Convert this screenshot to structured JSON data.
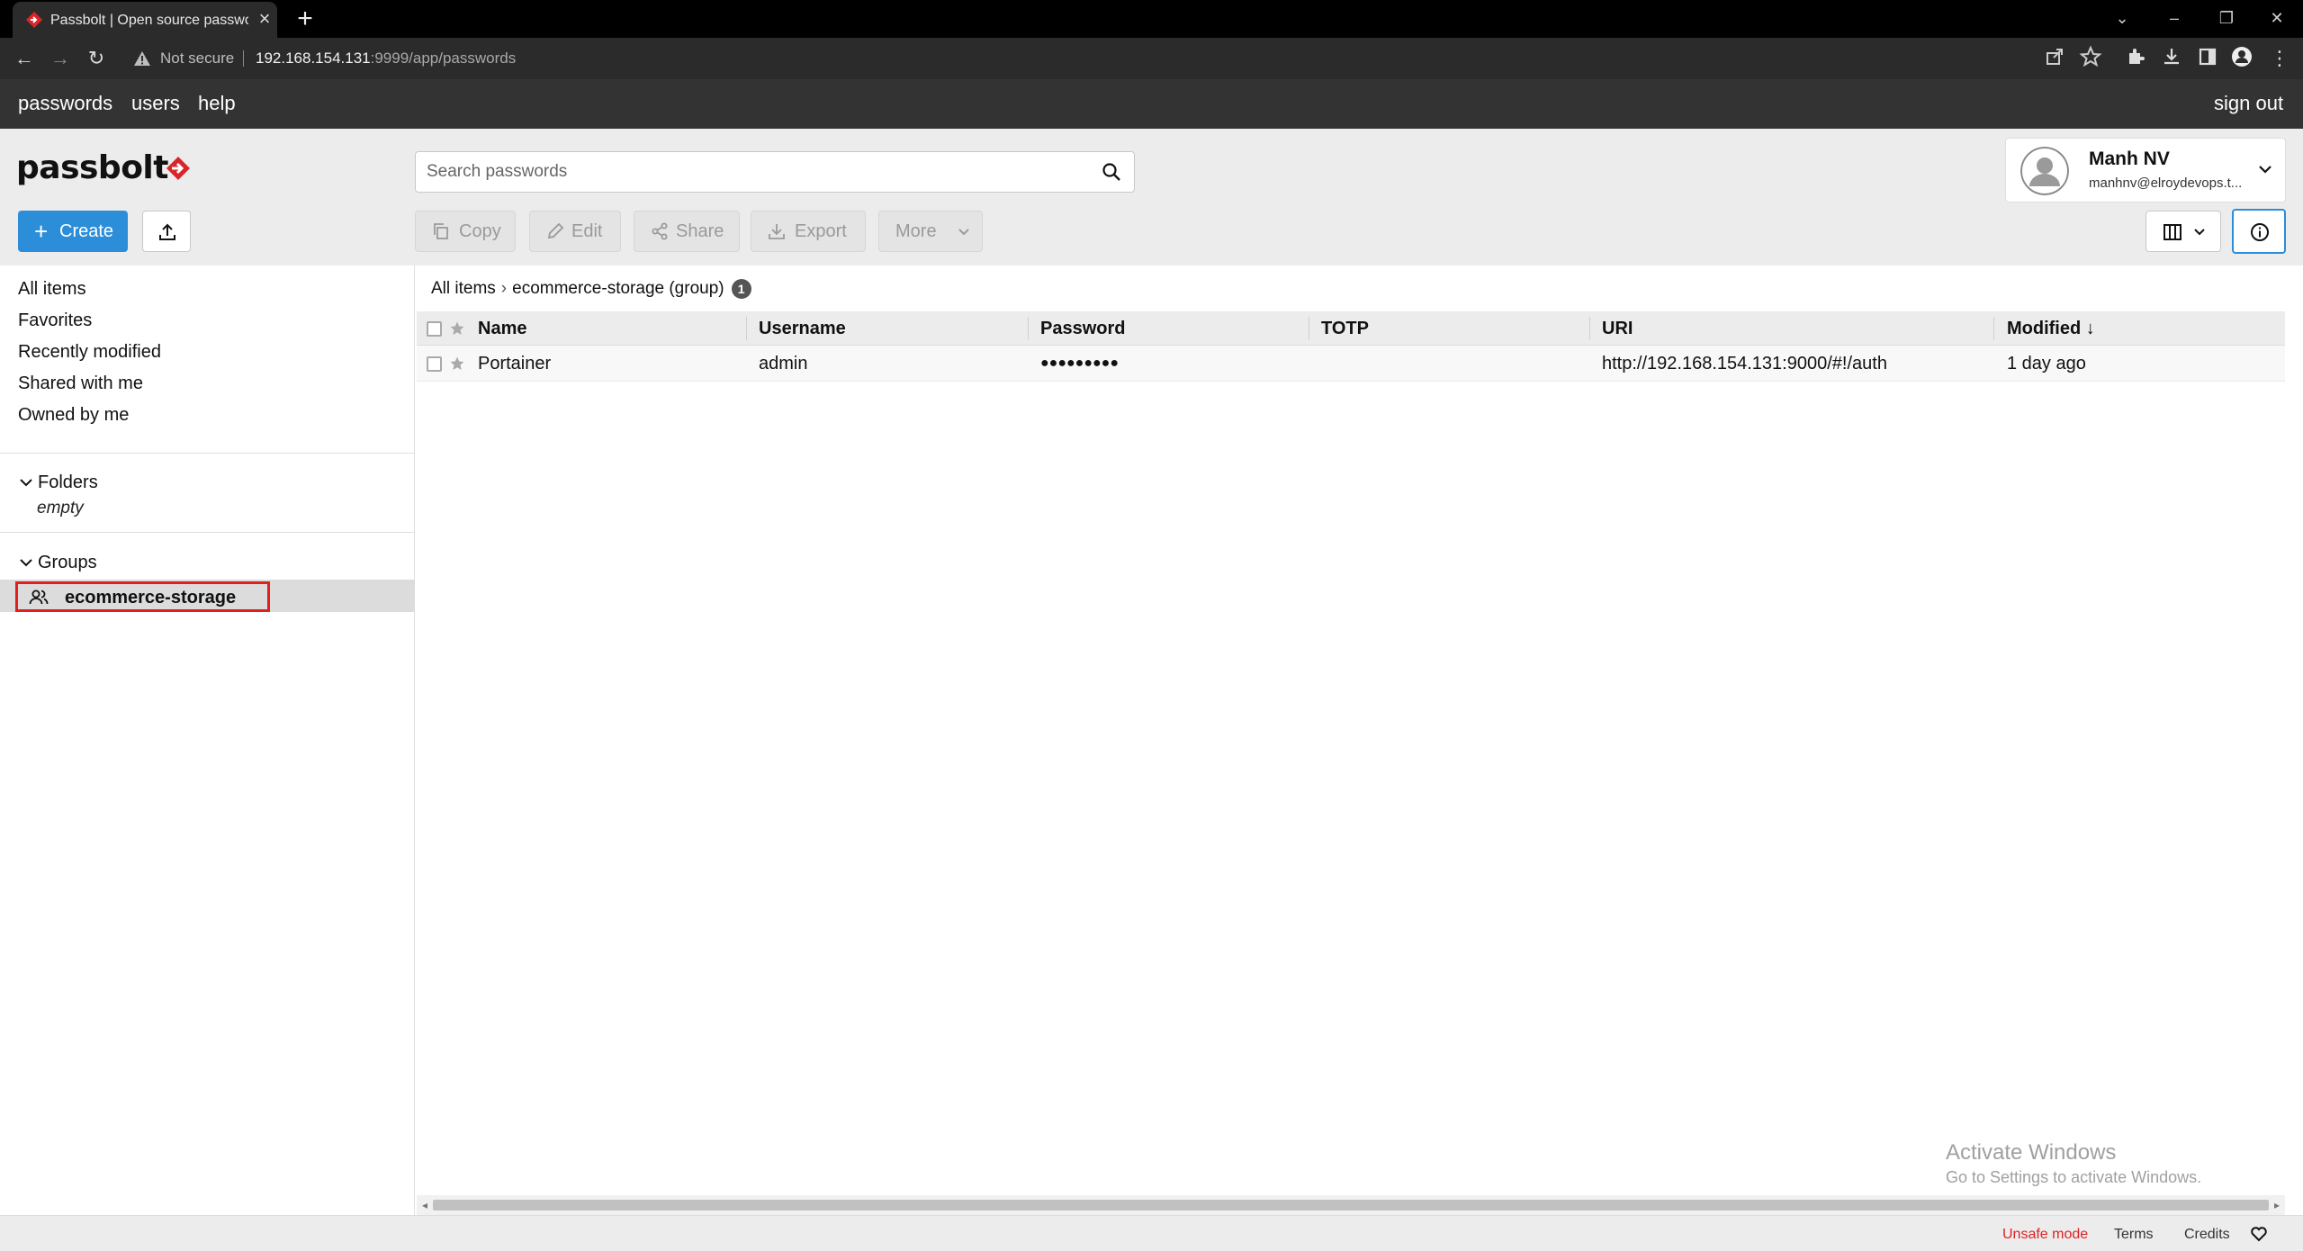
{
  "browser": {
    "tab_title": "Passbolt | Open source password manager",
    "security_label": "Not secure",
    "url_host": "192.168.154.131",
    "url_rest": ":9999/app/passwords"
  },
  "topnav": {
    "passwords": "passwords",
    "users": "users",
    "help": "help",
    "sign_out": "sign out"
  },
  "header": {
    "logo": "passbolt",
    "search_placeholder": "Search passwords",
    "user_name": "Manh NV",
    "user_email": "manhnv@elroydevops.t..."
  },
  "toolbar": {
    "create": "Create",
    "copy": "Copy",
    "edit": "Edit",
    "share": "Share",
    "export": "Export",
    "more": "More"
  },
  "sidebar": {
    "filters": [
      "All items",
      "Favorites",
      "Recently modified",
      "Shared with me",
      "Owned by me"
    ],
    "folders_label": "Folders",
    "folders_empty": "empty",
    "groups_label": "Groups",
    "group_selected": "ecommerce-storage"
  },
  "breadcrumb": {
    "root": "All items",
    "separator": "›",
    "current": "ecommerce-storage (group)",
    "count": "1"
  },
  "grid": {
    "columns": {
      "name": "Name",
      "username": "Username",
      "password": "Password",
      "totp": "TOTP",
      "uri": "URI",
      "modified": "Modified ↓"
    },
    "rows": [
      {
        "name": "Portainer",
        "username": "admin",
        "password": "●●●●●●●●●",
        "totp": "",
        "uri": "http://192.168.154.131:9000/#!/auth",
        "modified": "1 day ago"
      }
    ]
  },
  "watermark": {
    "title": "Activate Windows",
    "subtitle": "Go to Settings to activate Windows."
  },
  "footer": {
    "unsafe": "Unsafe mode",
    "terms": "Terms",
    "credits": "Credits"
  },
  "colors": {
    "brand_blue": "#2c8dd9",
    "topnav_bg": "#333333",
    "highlight_red": "#e02020",
    "unsafe_red": "#dd2222"
  }
}
